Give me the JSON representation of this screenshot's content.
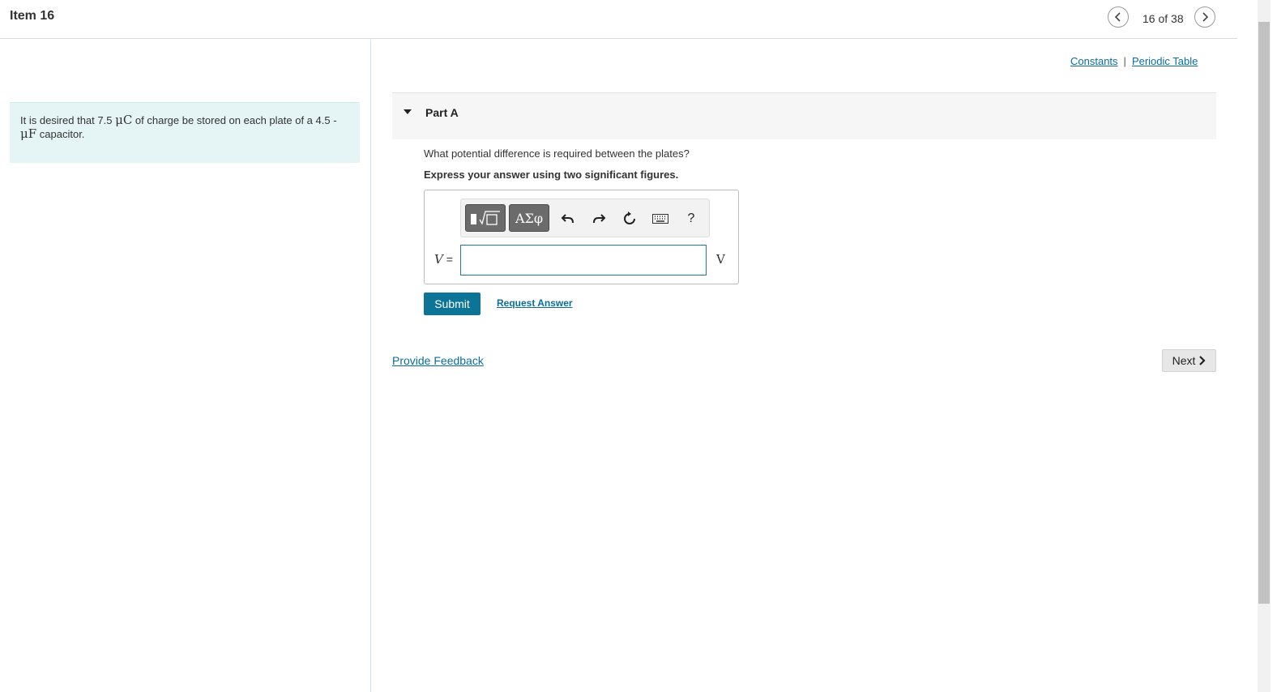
{
  "header": {
    "title": "Item 16",
    "counter": "16 of 38",
    "prev_icon": "chevron-left-icon",
    "next_icon": "chevron-right-icon"
  },
  "problem": {
    "text_part1": "It is desired that 7.5 ",
    "unit1": "μC",
    "text_part2": " of charge be stored on each plate of a 4.5 -",
    "unit2": "μF",
    "text_part3": " capacitor."
  },
  "links": {
    "constants": "Constants",
    "separator": "|",
    "periodic_table": "Periodic Table"
  },
  "part": {
    "title": "Part A",
    "question": "What potential difference is required between the plates?",
    "instruction": "Express your answer using two significant figures."
  },
  "toolbar": {
    "templates_icon": "math-templates-icon",
    "greek_label": "ΑΣφ",
    "undo_icon": "undo-icon",
    "redo_icon": "redo-icon",
    "reset_icon": "reset-icon",
    "keyboard_icon": "keyboard-icon",
    "help_label": "?"
  },
  "answer": {
    "variable": "V",
    "equals": " =",
    "value": "",
    "unit": "V"
  },
  "actions": {
    "submit_label": "Submit",
    "request_answer_label": "Request Answer",
    "feedback_label": "Provide Feedback",
    "next_label": "Next"
  },
  "colors": {
    "accent": "#0b7497",
    "link": "#0a6d9c",
    "problem_bg": "#e5f4f4"
  }
}
